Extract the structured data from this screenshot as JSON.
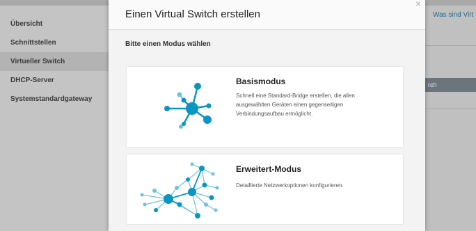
{
  "sidebar": {
    "items": [
      {
        "label": "Übersicht"
      },
      {
        "label": "Schnittstellen"
      },
      {
        "label": "Virtueller Switch"
      },
      {
        "label": "DHCP-Server"
      },
      {
        "label": "Systemstandardgateway"
      }
    ]
  },
  "right_panel": {
    "help_link": "Was sind Virt",
    "button_label": "rch"
  },
  "modal": {
    "title": "Einen Virtual Switch erstellen",
    "close_glyph": "×",
    "subtitle": "Bitte einen Modus wählen",
    "cards": [
      {
        "title": "Basismodus",
        "description": "Schnell eine Standard-Bridge erstellen, die allen ausgewählten Geräten einen gegenseitigen Verbindungsaufbau ermöglicht.",
        "icon": "simple-network-icon"
      },
      {
        "title": "Erweitert-Modus",
        "description": "Detaillierte Netzwerkoptionen konfigurieren.",
        "icon": "complex-network-icon"
      }
    ]
  },
  "colors": {
    "node_primary": "#0a95c2",
    "node_light": "#6cc3e0",
    "link_blue": "#1e6b8c"
  }
}
